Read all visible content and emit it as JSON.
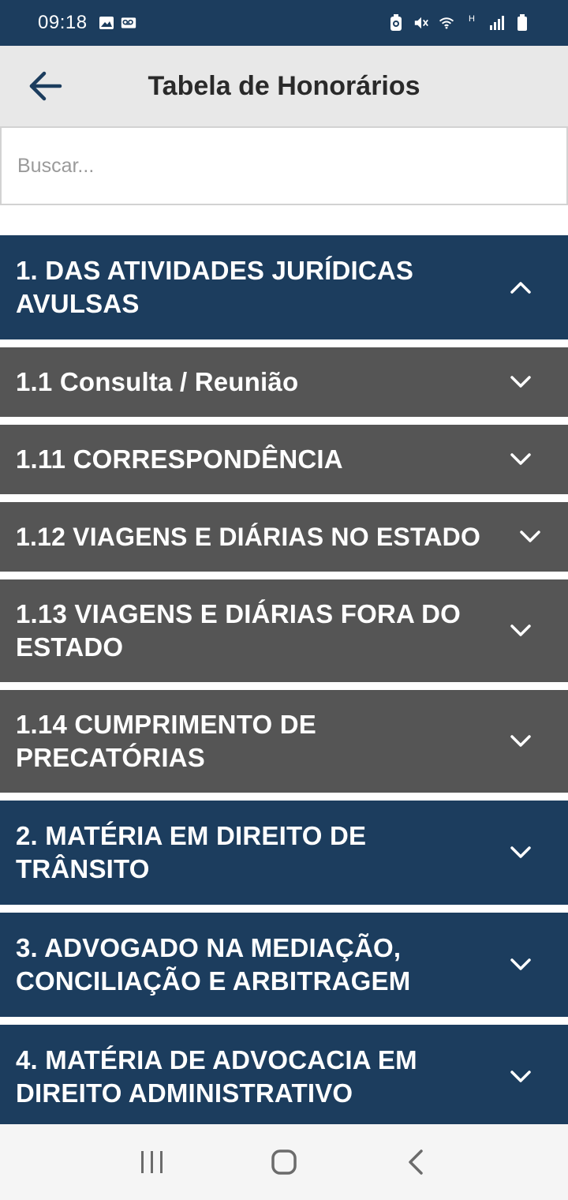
{
  "status_bar": {
    "time": "09:18",
    "left_icons": [
      "image-icon",
      "voicemail-icon"
    ],
    "right_icons": [
      "battery-saver-icon",
      "mute-icon",
      "wifi-icon",
      "h-network-icon",
      "signal-icon",
      "battery-icon"
    ],
    "network_type": "H"
  },
  "app_bar": {
    "title": "Tabela de Honorários",
    "back_icon": "arrow-left-icon"
  },
  "search": {
    "placeholder": "Buscar...",
    "value": ""
  },
  "sections": [
    {
      "label": "1. DAS ATIVIDADES JURÍDICAS AVULSAS",
      "expanded": true,
      "level": 1
    },
    {
      "label": "1.1 Consulta / Reunião",
      "expanded": false,
      "level": 2
    },
    {
      "label": "1.11 CORRESPONDÊNCIA",
      "expanded": false,
      "level": 2
    },
    {
      "label": "1.12 VIAGENS E DIÁRIAS NO ESTADO",
      "expanded": false,
      "level": 2
    },
    {
      "label": "1.13 VIAGENS E DIÁRIAS FORA DO ESTADO",
      "expanded": false,
      "level": 2
    },
    {
      "label": "1.14 CUMPRIMENTO DE PRECATÓRIAS",
      "expanded": false,
      "level": 2
    },
    {
      "label": "2. MATÉRIA EM DIREITO DE TRÂNSITO",
      "expanded": false,
      "level": 1
    },
    {
      "label": "3. ADVOGADO NA MEDIAÇÃO, CONCILIAÇÃO E ARBITRAGEM",
      "expanded": false,
      "level": 1
    },
    {
      "label": "4. MATÉRIA DE ADVOCACIA EM DIREITO ADMINISTRATIVO",
      "expanded": false,
      "level": 1
    }
  ],
  "colors": {
    "primary": "#1c3d5e",
    "subsection": "#555555",
    "app_bar": "#e8e8e8"
  },
  "nav_bar": {
    "buttons": [
      "recent-apps-icon",
      "home-icon",
      "back-nav-icon"
    ]
  }
}
